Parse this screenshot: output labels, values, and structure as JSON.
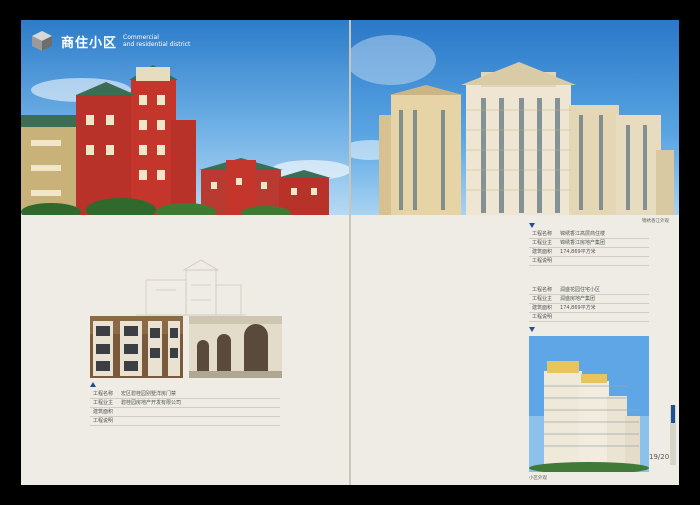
{
  "header": {
    "title": "商住小区",
    "subtitle_line1": "Commercial",
    "subtitle_line2": "and residential district"
  },
  "left_project": {
    "rows": [
      {
        "label": "工程名称",
        "value": "宏区碧桂园别墅洋房门禁"
      },
      {
        "label": "工程业主",
        "value": "碧桂园房地产开发有限公司"
      },
      {
        "label": "建筑面积",
        "value": ""
      },
      {
        "label": "工程说明",
        "value": ""
      }
    ]
  },
  "right_project_1": {
    "rows": [
      {
        "label": "工程名称",
        "value": "锦绣香江高层商住楼"
      },
      {
        "label": "工程业主",
        "value": "锦绣香江房地产集团"
      },
      {
        "label": "建筑面积",
        "value": "174,869平方米"
      },
      {
        "label": "工程说明",
        "value": ""
      }
    ]
  },
  "right_project_2": {
    "rows": [
      {
        "label": "工程名称",
        "value": "润盛花园住宅小区"
      },
      {
        "label": "工程业主",
        "value": "润盛房地产集团"
      },
      {
        "label": "建筑面积",
        "value": "174,869平方米"
      },
      {
        "label": "工程说明",
        "value": ""
      }
    ]
  },
  "captions": {
    "top_right_photo": "锦绣香江外观",
    "bottom_right_photo": "小区外观"
  },
  "page_number": "19/20",
  "colors": {
    "accent": "#1f4f96",
    "paper": "#eeece4"
  }
}
